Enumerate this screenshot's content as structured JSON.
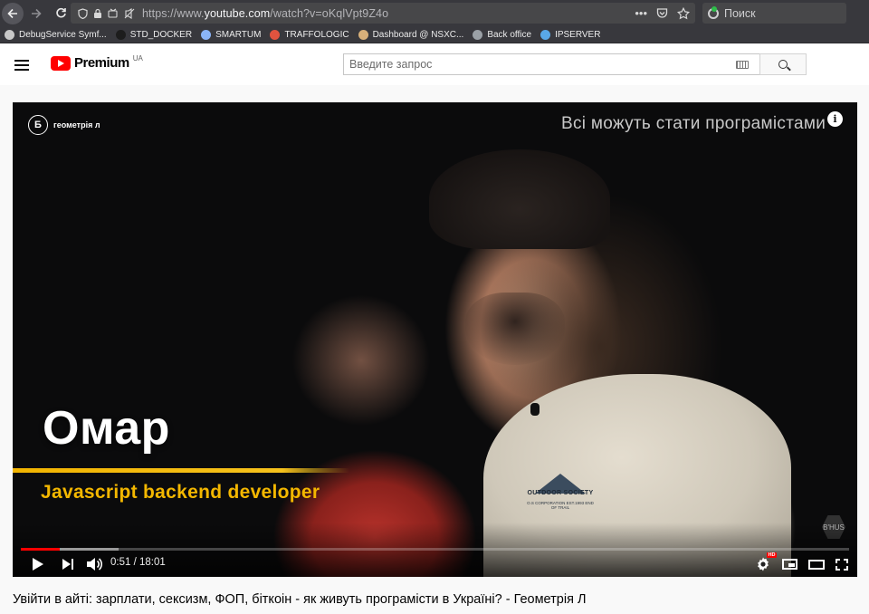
{
  "browser": {
    "url_prefix": "https://www.",
    "url_host": "youtube.com",
    "url_path": "/watch?v=oKqlVpt9Z4o",
    "search_placeholder": "Поиск",
    "bookmarks": [
      {
        "label": "DebugService Symf...",
        "color": "#c9c9c9"
      },
      {
        "label": "STD_DOCKER",
        "color": "#1d1d1d"
      },
      {
        "label": "SMARTUM",
        "color": "#8ab4f8"
      },
      {
        "label": "TRAFFOLOGIC",
        "color": "#e0533f"
      },
      {
        "label": "Dashboard @ NSXC...",
        "color": "#d8b07a"
      },
      {
        "label": "Back office",
        "color": "#9aa0a6"
      },
      {
        "label": "IPSERVER",
        "color": "#59a8e8"
      }
    ]
  },
  "youtube": {
    "logo_text": "Premium",
    "region": "UA",
    "search_placeholder": "Введите запрос"
  },
  "player": {
    "channel_badge": "Б",
    "channel_name": "геометрія л",
    "tagline": "Всі можуть стати програмістами",
    "info_glyph": "i",
    "lower_third_name": "Омар",
    "lower_third_role": "Javascript backend developer",
    "shirt_print": "OUTDOOR SOCIETY",
    "shirt_print_sub": "O.S CORPORATION EST.1993 END OF TRAIL",
    "watermark": "B'HUS",
    "time_current": "0:51",
    "time_separator": " / ",
    "time_total": "18:01",
    "played_fraction": 0.047,
    "buffered_fraction": 0.118,
    "hd_badge": "HD"
  },
  "video": {
    "title": "Увійти в айті: зарплати, сексизм, ФОП, біткоін - як живуть програмісти в Україні? - Геометрія Л"
  }
}
